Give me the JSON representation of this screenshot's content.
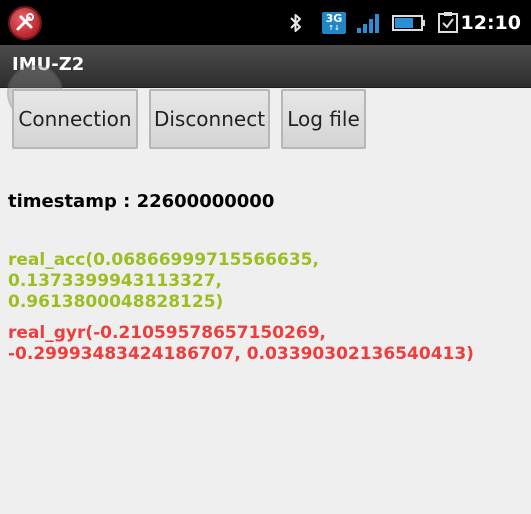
{
  "status_bar": {
    "time": "12:10",
    "network_label": "3G",
    "network_arrows": "↑↓",
    "icons": [
      "tools-app-icon",
      "bluetooth-icon",
      "3g-icon",
      "signal-icon",
      "battery-icon",
      "clipboard-check-icon"
    ]
  },
  "app": {
    "title": "IMU-Z2"
  },
  "buttons": {
    "connection": "Connection",
    "disconnect": "Disconnect",
    "log_file": "Log file"
  },
  "readouts": {
    "timestamp": "timestamp : 22600000000",
    "real_acc_lines": [
      "real_acc(0.06866999715566635,",
      "0.1373399943113327,",
      "0.9613800048828125)"
    ],
    "real_gyr_lines": [
      "real_gyr(-0.21059578657150269,",
      "-0.29993483424186707, 0.03390302136540413)"
    ]
  },
  "colors": {
    "acc": "#9dbe22",
    "gyr": "#ef3d3d",
    "background": "#efefef",
    "title_bar": "#3a3a3a"
  }
}
